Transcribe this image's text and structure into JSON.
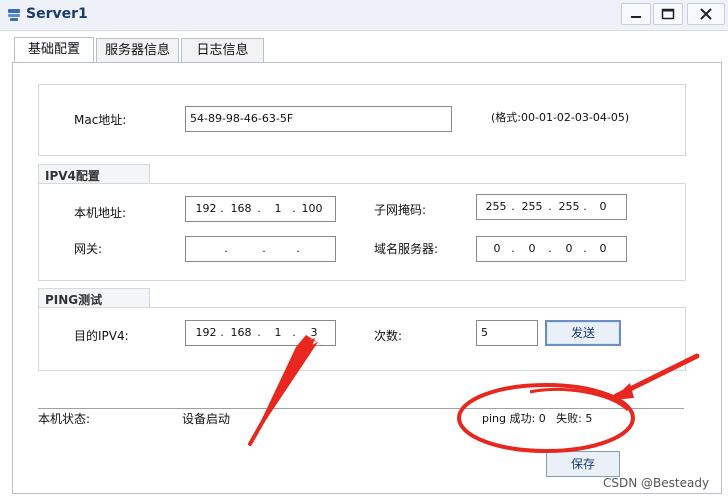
{
  "window": {
    "title": "Server1"
  },
  "icons": {
    "app": "server-app-icon",
    "minimize": "minimize-icon",
    "maximize": "maximize-icon",
    "close": "close-icon"
  },
  "tabs": [
    {
      "label": "基础配置",
      "active": true
    },
    {
      "label": "服务器信息",
      "active": false
    },
    {
      "label": "日志信息",
      "active": false
    }
  ],
  "mac": {
    "label": "Mac地址:",
    "value": "54-89-98-46-63-5F",
    "hint": "(格式:00-01-02-03-04-05)"
  },
  "ipv4": {
    "section_title": "IPV4配置",
    "local_ip_label": "本机地址:",
    "local_ip": [
      "192",
      "168",
      "1",
      "100"
    ],
    "subnet_label": "子网掩码:",
    "subnet": [
      "255",
      "255",
      "255",
      "0"
    ],
    "gateway_label": "网关:",
    "gateway": [
      "",
      "",
      "",
      ""
    ],
    "dns_label": "域名服务器:",
    "dns": [
      "0",
      "0",
      "0",
      "0"
    ]
  },
  "ping": {
    "section_title": "PING测试",
    "dest_label": "目的IPV4:",
    "dest": [
      "192",
      "168",
      "1",
      "3"
    ],
    "count_label": "次数:",
    "count": "5",
    "send_label": "发送"
  },
  "status": {
    "label": "本机状态:",
    "value": "设备启动",
    "result": "ping 成功: 0   失败: 5"
  },
  "save_label": "保存",
  "watermark": "CSDN @Besteady",
  "colors": {
    "annotation_red": "#e8281e",
    "title_text": "#1b3b6f"
  }
}
